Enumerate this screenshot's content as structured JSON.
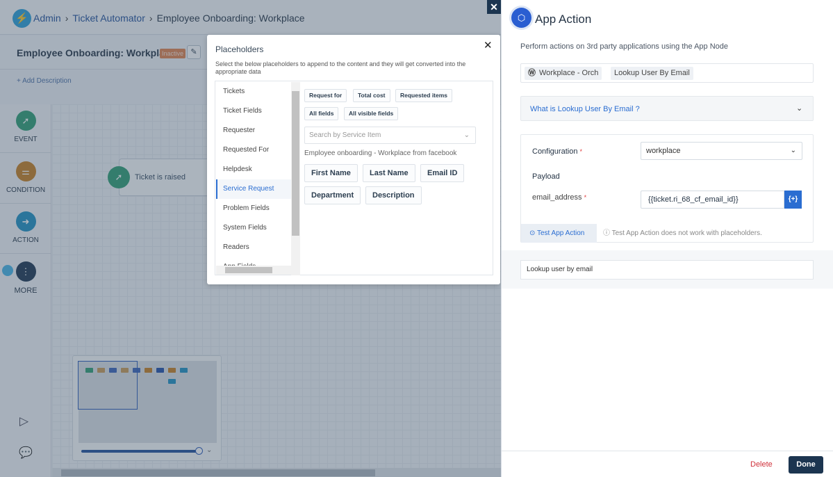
{
  "breadcrumb": {
    "items": [
      "Admin",
      "Ticket Automator",
      "Employee Onboarding: Workplace"
    ]
  },
  "workflow": {
    "title": "Employee Onboarding: Workplace",
    "status": "Inactive",
    "add_description": "+ Add Description"
  },
  "rail": {
    "items": [
      {
        "label": "EVENT",
        "color": "#2e9e72"
      },
      {
        "label": "CONDITION",
        "color": "#c77e1f"
      },
      {
        "label": "ACTION",
        "color": "#1e8fc2"
      },
      {
        "label": "MORE",
        "color": "#1c3550"
      }
    ]
  },
  "canvas": {
    "node": {
      "label": "Ticket is raised",
      "icon": "event-cursor-icon"
    }
  },
  "zoom_slider": {
    "value_percent": 100
  },
  "placeholders": {
    "title": "Placeholders",
    "description": "Select the below placeholders to append to the content and they will get converted into the appropriate data",
    "categories": [
      "Tickets",
      "Ticket Fields",
      "Requester",
      "Requested For",
      "Helpdesk",
      "Service Request",
      "Problem Fields",
      "System Fields",
      "Readers",
      "App Fields"
    ],
    "active_category": "Service Request",
    "general_chips": [
      "Request for",
      "Total cost",
      "Requested items",
      "All fields",
      "All visible fields"
    ],
    "search_placeholder": "Search by Service Item",
    "service_item": "Employee onboarding - Workplace from facebook",
    "item_fields": [
      "First Name",
      "Last Name",
      "Email ID",
      "Department",
      "Description"
    ]
  },
  "panel": {
    "title": "App Action",
    "description": "Perform actions on 3rd party applications using the App Node",
    "app": "Workplace - Orch",
    "action": "Lookup User By Email",
    "what_is": "What is Lookup User By Email ?",
    "configuration_label": "Configuration",
    "configuration_value": "workplace",
    "payload_label": "Payload",
    "field_label": "email_address",
    "field_value": "{{ticket.ri_68_cf_email_id}}",
    "placeholder_button": "{+}",
    "test_button": "Test App Action",
    "test_note": "Test App Action does not work with placeholders.",
    "note": "Lookup user by email",
    "delete": "Delete",
    "done": "Done",
    "required_mark": "*"
  }
}
